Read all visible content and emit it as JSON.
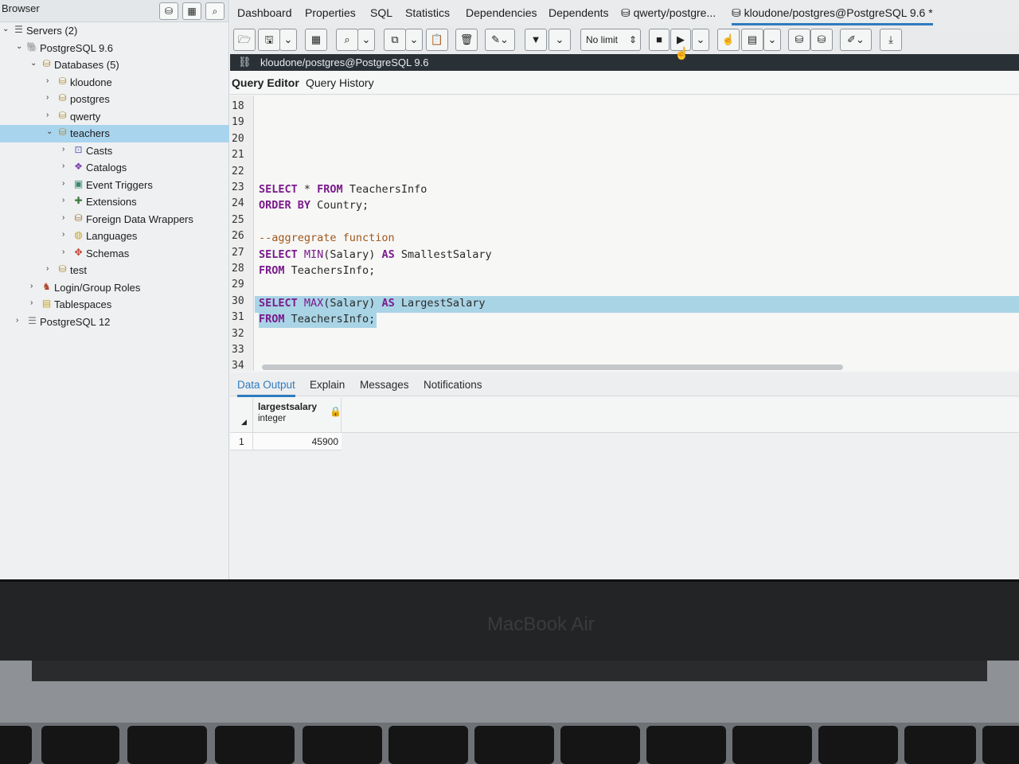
{
  "browser": {
    "title": "Browser",
    "tree": [
      {
        "label": "Servers (2)",
        "icon": "servers-icon",
        "level": 0,
        "expanded": true
      },
      {
        "label": "PostgreSQL 9.6",
        "icon": "elephant-icon",
        "level": 1,
        "expanded": true
      },
      {
        "label": "Databases (5)",
        "icon": "databases-icon",
        "level": 2,
        "expanded": true
      },
      {
        "label": "kloudone",
        "icon": "database-icon",
        "level": 3,
        "expanded": false
      },
      {
        "label": "postgres",
        "icon": "database-icon",
        "level": 3,
        "expanded": false
      },
      {
        "label": "qwerty",
        "icon": "database-icon",
        "level": 3,
        "expanded": false
      },
      {
        "label": "teachers",
        "icon": "database-icon",
        "level": 3,
        "expanded": true,
        "selected": true
      },
      {
        "label": "Casts",
        "icon": "casts-icon",
        "level": 4,
        "expanded": false
      },
      {
        "label": "Catalogs",
        "icon": "catalogs-icon",
        "level": 4,
        "expanded": false
      },
      {
        "label": "Event Triggers",
        "icon": "event-triggers-icon",
        "level": 4,
        "expanded": false
      },
      {
        "label": "Extensions",
        "icon": "extensions-icon",
        "level": 4,
        "expanded": false
      },
      {
        "label": "Foreign Data Wrappers",
        "icon": "foreign-data-wrappers-icon",
        "level": 4,
        "expanded": false
      },
      {
        "label": "Languages",
        "icon": "languages-icon",
        "level": 4,
        "expanded": false
      },
      {
        "label": "Schemas",
        "icon": "schemas-icon",
        "level": 4,
        "expanded": false
      },
      {
        "label": "test",
        "icon": "database-icon",
        "level": 3,
        "expanded": false
      },
      {
        "label": "Login/Group Roles",
        "icon": "roles-icon",
        "level": 2,
        "expanded": false
      },
      {
        "label": "Tablespaces",
        "icon": "tablespaces-icon",
        "level": 2,
        "expanded": false
      },
      {
        "label": "PostgreSQL 12",
        "icon": "server-disconnected-icon",
        "level": 1,
        "expanded": false
      }
    ]
  },
  "tabs": {
    "dashboard": "Dashboard",
    "properties": "Properties",
    "sql": "SQL",
    "statistics": "Statistics",
    "dependencies": "Dependencies",
    "dependents": "Dependents",
    "query1": "qwerty/postgre...",
    "query2": "kloudone/postgres@PostgreSQL 9.6 *"
  },
  "toolbar": {
    "limit": "No limit"
  },
  "connection": "kloudone/postgres@PostgreSQL 9.6",
  "query_tabs": {
    "editor": "Query Editor",
    "history": "Query History"
  },
  "editor": {
    "lines": [
      "18",
      "19",
      "20",
      "21",
      "22",
      "23",
      "24",
      "25",
      "26",
      "27",
      "28",
      "29",
      "30",
      "31",
      "32",
      "33",
      "34"
    ],
    "code": {
      "l23_kw1": "SELECT",
      "l23_rest1": " * ",
      "l23_kw2": "FROM",
      "l23_rest2": " TeachersInfo",
      "l24_kw1": "ORDER BY",
      "l24_rest": " Country;",
      "l26_comment": "--aggregrate function",
      "l27_kw1": "SELECT",
      "l27_fn": " MIN",
      "l27_rest1": "(Salary) ",
      "l27_kw2": "AS",
      "l27_rest2": " SmallestSalary",
      "l28_kw1": "FROM",
      "l28_rest": " TeachersInfo;",
      "l30_kw1": "SELECT",
      "l30_fn": " MAX",
      "l30_rest1": "(Salary) ",
      "l30_kw2": "AS",
      "l30_rest2": " LargestSalary",
      "l31_kw1": "FROM",
      "l31_rest": " TeachersInfo;"
    }
  },
  "results": {
    "tabs": {
      "data_output": "Data Output",
      "explain": "Explain",
      "messages": "Messages",
      "notifications": "Notifications"
    },
    "column_name": "largestsalary",
    "column_type": "integer",
    "row_number": "1",
    "value": "45900"
  },
  "laptop": {
    "brand": "MacBook Air"
  }
}
